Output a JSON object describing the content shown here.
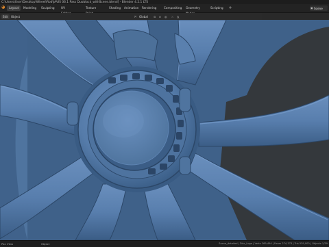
{
  "window": {
    "title": "C:\\Users\\User\\Desktop\\Wheel\\Rod\\JAVIS 06.1 Pass Duoblock_withScene.blend] - Blender 4.2.1 LTS"
  },
  "app": {
    "logo_icon": "blender-logo-icon"
  },
  "menu": [
    "Layout",
    "Modeling",
    "Sculpting",
    "UV Editing",
    "Texture Paint",
    "Shading",
    "Animation",
    "Rendering",
    "Compositing",
    "Geometry Nodes",
    "Scripting"
  ],
  "active_workspace": "Layout",
  "scene": {
    "label": "Scene",
    "icon": "scene-icon"
  },
  "viewport_header": {
    "mode": "Edit",
    "object_label": "Object",
    "orientation": "Global",
    "pivot_icon": "pivot-icon",
    "snap_icon": "magnet-icon",
    "proportional_icon": "proportional-icon"
  },
  "status": {
    "left": "Pan View",
    "middle": "Object",
    "right": "Scene_detailed | Disc_Logo | Verts 269,494 | Faces 274,373 | Tris 539,000 | Objects 1/39"
  },
  "colors": {
    "wheel": "#5b81b0",
    "wheel_dark": "#3a5c85",
    "wheel_shadow": "#2a4566",
    "background": "#323436",
    "accent": "#e48b2b"
  }
}
